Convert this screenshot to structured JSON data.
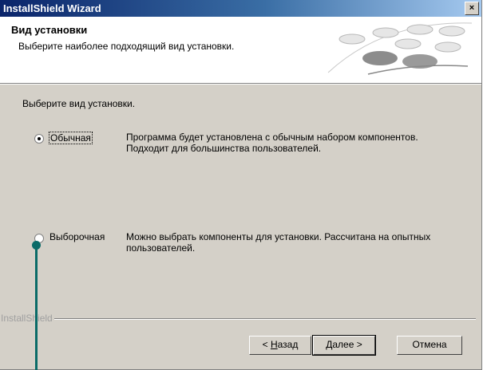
{
  "window": {
    "title": "InstallShield Wizard",
    "close_glyph": "×"
  },
  "header": {
    "title": "Вид установки",
    "subtitle": "Выберите наиболее подходящий вид установки."
  },
  "prompt": "Выберите вид установки.",
  "options": [
    {
      "label": "Обычная",
      "checked": true,
      "desc_line1": "Программа будет установлена с обычным набором компонентов.",
      "desc_line2": "Подходит для большинства пользователей."
    },
    {
      "label": "Выборочная",
      "checked": false,
      "desc_line1": "Можно выбрать компоненты для установки. Рассчитана на опытных",
      "desc_line2": "пользователей."
    }
  ],
  "footer": {
    "brand": "InstallShield"
  },
  "buttons": {
    "back_prefix": "< ",
    "back_mnemonic": "Н",
    "back_rest": "азад",
    "next_mnemonic": "Д",
    "next_rest": "алее >",
    "cancel": "Отмена"
  },
  "colors": {
    "titlebar": "#0a246a",
    "dialog": "#d4d0c8",
    "callout": "#0a6b68"
  }
}
